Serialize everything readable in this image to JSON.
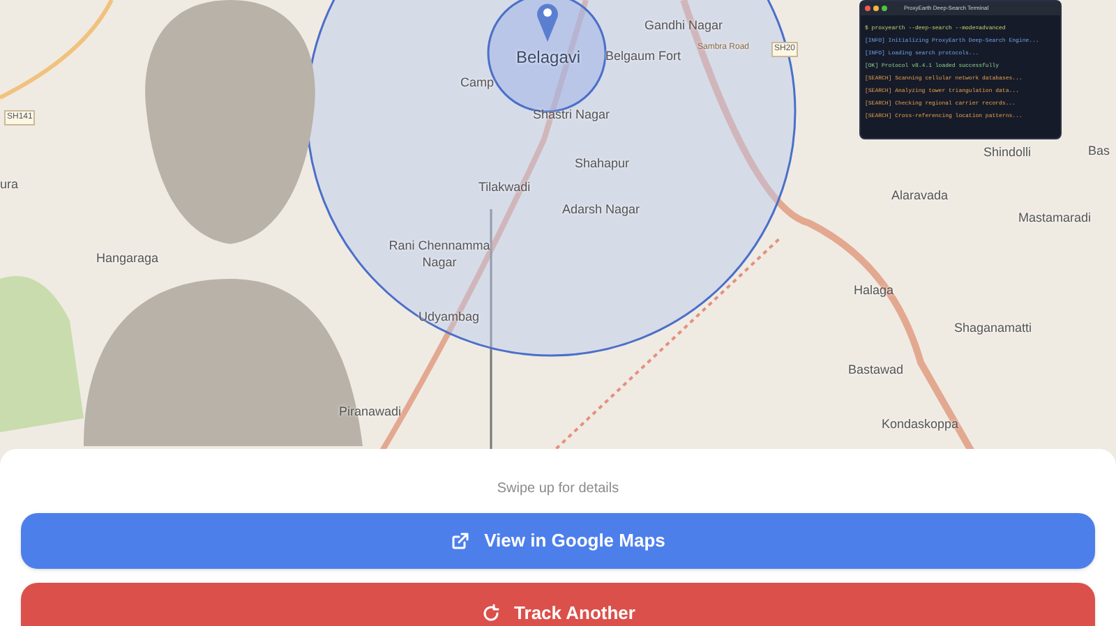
{
  "map": {
    "labels": [
      {
        "text": "Belagavi",
        "kind": "city"
      },
      {
        "text": "Gandhi Nagar",
        "kind": "place"
      },
      {
        "text": "Belgaum Fort",
        "kind": "place"
      },
      {
        "text": "Sambra Road",
        "kind": "road"
      },
      {
        "text": "SH20",
        "kind": "shield"
      },
      {
        "text": "Camp",
        "kind": "place"
      },
      {
        "text": "Shastri Nagar",
        "kind": "place"
      },
      {
        "text": "SH141",
        "kind": "shield"
      },
      {
        "text": "Shahapur",
        "kind": "place"
      },
      {
        "text": "Tilakwadi",
        "kind": "place"
      },
      {
        "text": "Adarsh Nagar",
        "kind": "place"
      },
      {
        "text": "Hangaraga",
        "kind": "place"
      },
      {
        "text": "Rani Chennamma Nagar",
        "kind": "place"
      },
      {
        "text": "Udyambag",
        "kind": "place"
      },
      {
        "text": "Piranawadi",
        "kind": "place"
      },
      {
        "text": "Shindolli",
        "kind": "place"
      },
      {
        "text": "Bas",
        "kind": "place"
      },
      {
        "text": "Alaravada",
        "kind": "place"
      },
      {
        "text": "Mastamaradi",
        "kind": "place"
      },
      {
        "text": "Halaga",
        "kind": "place"
      },
      {
        "text": "Shaganamatti",
        "kind": "place"
      },
      {
        "text": "Bastawad",
        "kind": "place"
      },
      {
        "text": "Kondaskoppa",
        "kind": "place"
      },
      {
        "text": "ura",
        "kind": "place"
      }
    ]
  },
  "terminal": {
    "title": "ProxyEarth Deep-Search Terminal",
    "lines": [
      {
        "text": "$ proxyearth --deep-search --mode=advanced",
        "kind": "command"
      },
      {
        "text": "[INFO] Initializing ProxyEarth Deep-Search Engine...",
        "kind": "info"
      },
      {
        "text": "[INFO] Loading search protocols...",
        "kind": "info"
      },
      {
        "text": "[OK] Protocol v8.4.1 loaded successfully",
        "kind": "ok"
      },
      {
        "text": "[SEARCH] Scanning cellular network databases...",
        "kind": "search"
      },
      {
        "text": "[SEARCH] Analyzing tower triangulation data...",
        "kind": "search"
      },
      {
        "text": "[SEARCH] Checking regional carrier records...",
        "kind": "search"
      },
      {
        "text": "[SEARCH] Cross-referencing location patterns...",
        "kind": "search"
      }
    ]
  },
  "sheet": {
    "hint": "Swipe up for details",
    "buttons": [
      {
        "label": "View in Google Maps",
        "kind": "open-map"
      },
      {
        "label": "Track Another",
        "kind": "retry"
      }
    ]
  }
}
